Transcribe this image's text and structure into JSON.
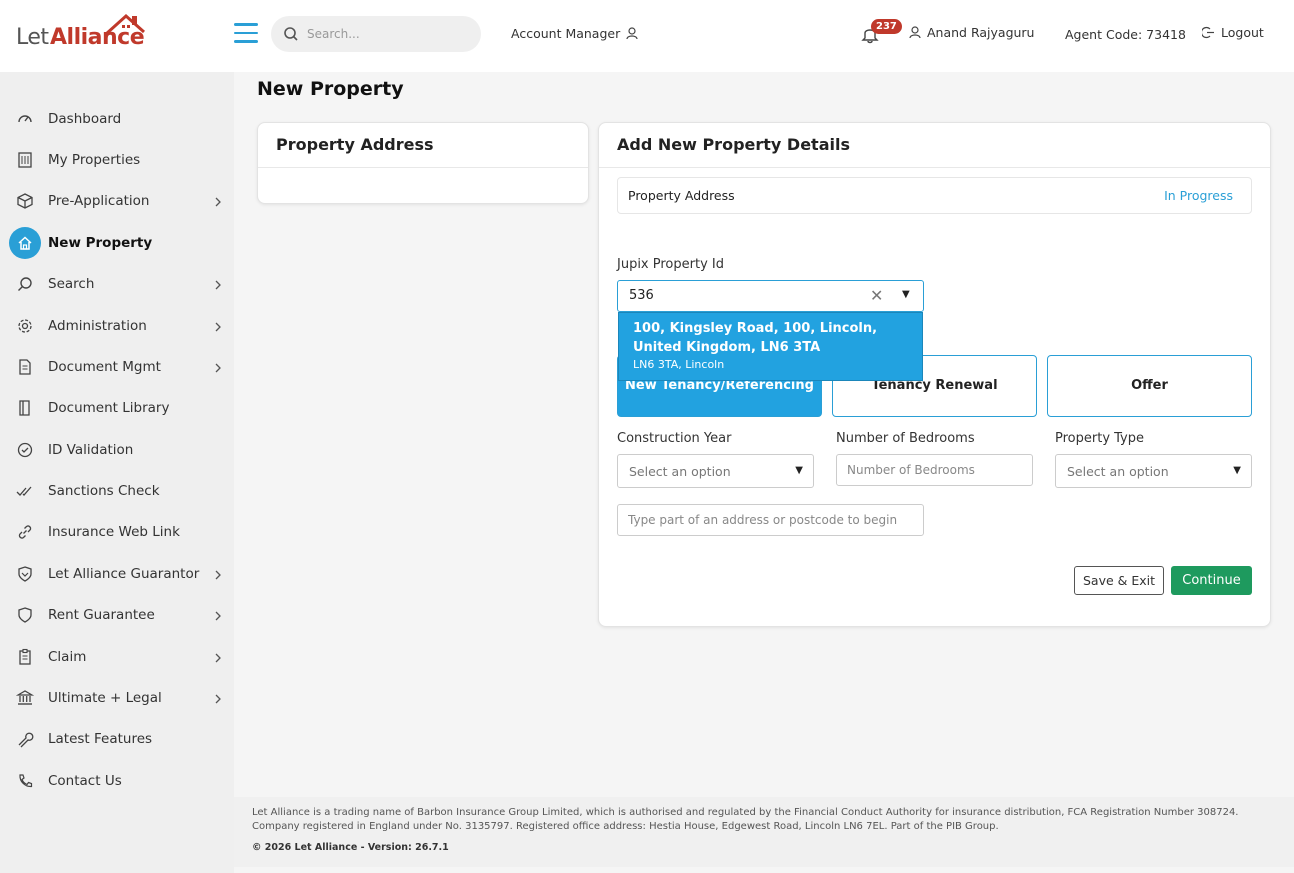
{
  "brand": {
    "let": "Let",
    "alliance": "Alliance"
  },
  "header": {
    "search_placeholder": "Search...",
    "account_manager": "Account Manager",
    "notification_count": "237",
    "user_name": "Anand Rajyaguru",
    "agent_code": "Agent Code: 73418",
    "logout": "Logout"
  },
  "sidebar": {
    "items": [
      {
        "label": "Dashboard",
        "icon": "gauge-icon",
        "chevron": false
      },
      {
        "label": "My Properties",
        "icon": "building-icon",
        "chevron": false
      },
      {
        "label": "Pre-Application",
        "icon": "box-icon",
        "chevron": true
      },
      {
        "label": "New Property",
        "icon": "home-icon",
        "chevron": false,
        "active": true
      },
      {
        "label": "Search",
        "icon": "search-icon",
        "chevron": true
      },
      {
        "label": "Administration",
        "icon": "gear-icon",
        "chevron": true
      },
      {
        "label": "Document Mgmt",
        "icon": "document-icon",
        "chevron": true
      },
      {
        "label": "Document Library",
        "icon": "book-icon",
        "chevron": false
      },
      {
        "label": "ID Validation",
        "icon": "check-circle-icon",
        "chevron": false
      },
      {
        "label": "Sanctions Check",
        "icon": "double-check-icon",
        "chevron": false
      },
      {
        "label": "Insurance Web Link",
        "icon": "link-icon",
        "chevron": false
      },
      {
        "label": "Let Alliance Guarantor",
        "icon": "shield-icon",
        "chevron": true
      },
      {
        "label": "Rent Guarantee",
        "icon": "shield-outline-icon",
        "chevron": true
      },
      {
        "label": "Claim",
        "icon": "clipboard-icon",
        "chevron": true
      },
      {
        "label": "Ultimate + Legal",
        "icon": "bank-icon",
        "chevron": true
      },
      {
        "label": "Latest Features",
        "icon": "wrench-icon",
        "chevron": false
      },
      {
        "label": "Contact Us",
        "icon": "phone-icon",
        "chevron": false
      }
    ]
  },
  "main": {
    "page_title": "New Property",
    "left_card_title": "Property Address",
    "right_card_title": "Add New Property Details",
    "progress": {
      "label": "Property Address",
      "status": "In Progress"
    },
    "jupix_label": "Jupix Property Id",
    "jupix_value": "536",
    "suggestion": {
      "main": "100, Kingsley Road, 100, Lincoln, United Kingdom, LN6 3TA",
      "sub": "LN6 3TA, Lincoln"
    },
    "types": [
      "New Tenancy/Referencing",
      "Tenancy Renewal",
      "Offer"
    ],
    "construction_label": "Construction Year",
    "construction_placeholder": "Select an option",
    "bedrooms_label": "Number of Bedrooms",
    "bedrooms_placeholder": "Number of Bedrooms",
    "property_type_label": "Property Type",
    "property_type_placeholder": "Select an option",
    "address_placeholder": "Type part of an address or postcode to begin",
    "save_exit": "Save & Exit",
    "continue": "Continue"
  },
  "footer": {
    "text": "Let Alliance is a trading name of Barbon Insurance Group Limited, which is authorised and regulated by the Financial Conduct Authority for insurance distribution, FCA Registration Number 308724. Company registered in England under No. 3135797. Registered office address: Hestia House, Edgewest Road, Lincoln LN6 7EL. Part of the PIB Group.",
    "version": "© 2026 Let Alliance - Version: 26.7.1"
  },
  "colors": {
    "accent": "#2a9fd6",
    "brand_red": "#c0392b",
    "continue_green": "#1e9a5e"
  }
}
